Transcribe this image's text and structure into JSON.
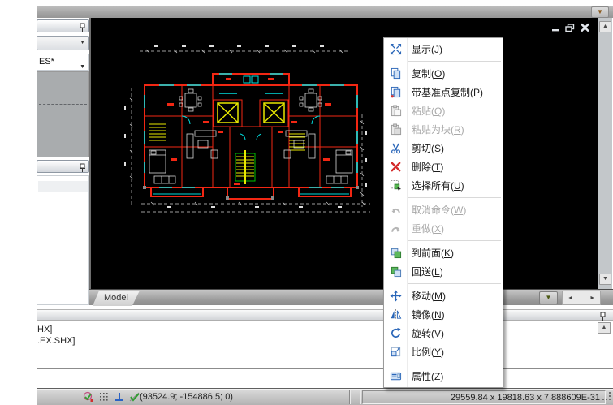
{
  "icons": {
    "chevron_down": "▼",
    "scroll_up": "▲",
    "scroll_down": "▼",
    "scroll_left": "◄",
    "scroll_right": "►"
  },
  "left_panel": {
    "layer_combo_value": "ES*"
  },
  "model_tab": {
    "label": "Model"
  },
  "command_panel": {
    "lines": [
      "HX]",
      ".EX.SHX]"
    ]
  },
  "status_bar": {
    "coordinates": "(93524.9; -154886.5; 0)",
    "dimensions": "29559.84 x 19818.63 x 7.888609E-31"
  },
  "context_menu": {
    "items": [
      {
        "type": "item",
        "name": "display",
        "label": "显示",
        "hotkey": "J",
        "icon": "zoom-extents",
        "disabled": false
      },
      {
        "type": "separator"
      },
      {
        "type": "item",
        "name": "copy",
        "label": "复制",
        "hotkey": "O",
        "icon": "copy",
        "disabled": false
      },
      {
        "type": "item",
        "name": "copy-with-basepoint",
        "label": "带基准点复制",
        "hotkey": "P",
        "icon": "copy-base",
        "disabled": false
      },
      {
        "type": "item",
        "name": "paste",
        "label": "粘贴",
        "hotkey": "Q",
        "icon": "paste",
        "disabled": true
      },
      {
        "type": "item",
        "name": "paste-as-block",
        "label": "粘贴为块",
        "hotkey": "R",
        "icon": "paste-block",
        "disabled": true
      },
      {
        "type": "item",
        "name": "cut",
        "label": "剪切",
        "hotkey": "S",
        "icon": "cut",
        "disabled": false
      },
      {
        "type": "item",
        "name": "delete",
        "label": "删除",
        "hotkey": "T",
        "icon": "delete",
        "disabled": false
      },
      {
        "type": "item",
        "name": "select-all",
        "label": "选择所有",
        "hotkey": "U",
        "icon": "select-all",
        "disabled": false
      },
      {
        "type": "separator"
      },
      {
        "type": "item",
        "name": "cancel-command",
        "label": "取消命令",
        "hotkey": "W",
        "icon": "undo",
        "disabled": true
      },
      {
        "type": "item",
        "name": "redo",
        "label": "重做",
        "hotkey": "X",
        "icon": "redo",
        "disabled": true
      },
      {
        "type": "separator"
      },
      {
        "type": "item",
        "name": "bring-to-front",
        "label": "到前面",
        "hotkey": "K",
        "icon": "bring-front",
        "disabled": false
      },
      {
        "type": "item",
        "name": "send-back",
        "label": "回送",
        "hotkey": "L",
        "icon": "send-back",
        "disabled": false
      },
      {
        "type": "separator"
      },
      {
        "type": "item",
        "name": "move",
        "label": "移动",
        "hotkey": "M",
        "icon": "move",
        "disabled": false
      },
      {
        "type": "item",
        "name": "mirror",
        "label": "镜像",
        "hotkey": "N",
        "icon": "mirror",
        "disabled": false
      },
      {
        "type": "item",
        "name": "rotate",
        "label": "旋转",
        "hotkey": "V",
        "icon": "rotate",
        "disabled": false
      },
      {
        "type": "item",
        "name": "scale",
        "label": "比例",
        "hotkey": "Y",
        "icon": "scale",
        "disabled": false
      },
      {
        "type": "separator"
      },
      {
        "type": "item",
        "name": "properties",
        "label": "属性",
        "hotkey": "Z",
        "icon": "properties",
        "disabled": false
      }
    ]
  }
}
